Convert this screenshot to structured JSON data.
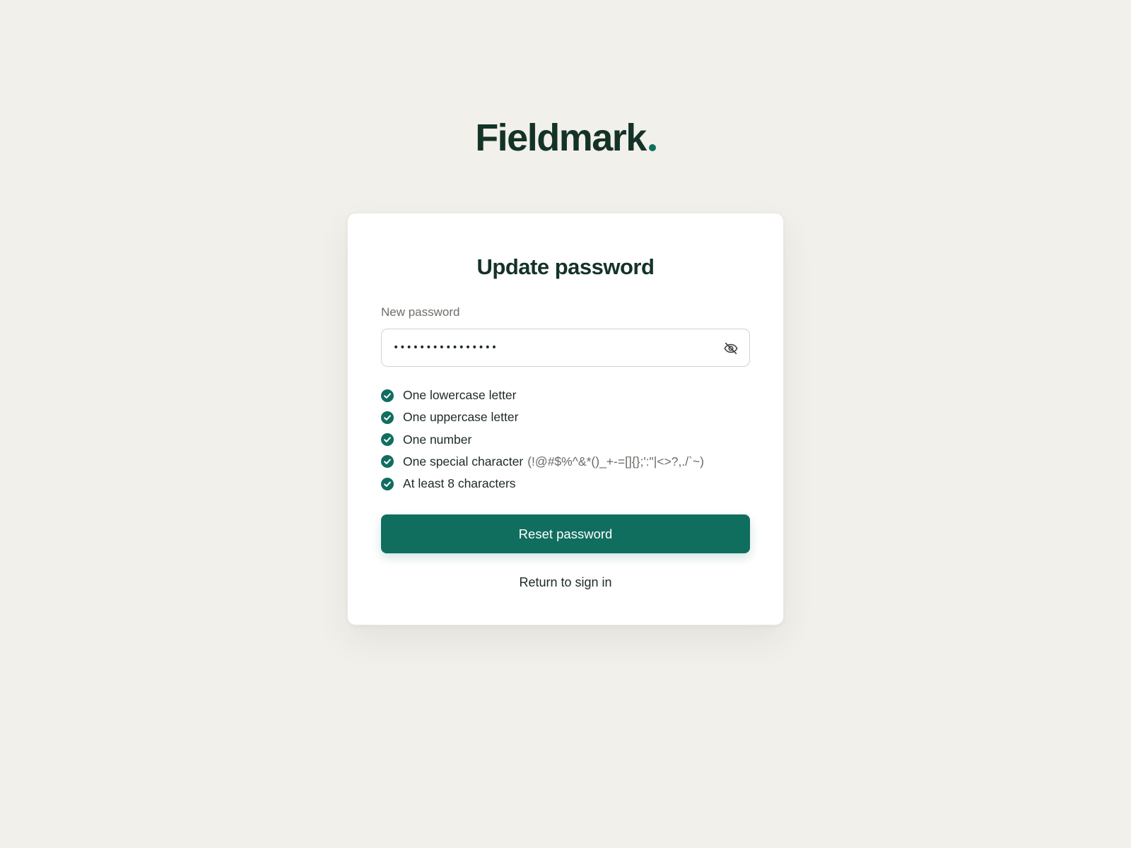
{
  "brand": {
    "name": "Fieldmark",
    "accent_color": "#106e5f",
    "text_color": "#143328"
  },
  "card": {
    "title": "Update password",
    "password_field": {
      "label": "New password",
      "value": "••••••••••••••••",
      "toggle_icon": "eye-off-icon"
    },
    "requirements": [
      {
        "label": "One lowercase letter",
        "hint": "",
        "met": true
      },
      {
        "label": "One uppercase letter",
        "hint": "",
        "met": true
      },
      {
        "label": "One number",
        "hint": "",
        "met": true
      },
      {
        "label": "One special character",
        "hint": "(!@#$%^&*()_+-=[]{};':\"|<>?,./`~)",
        "met": true
      },
      {
        "label": "At least 8 characters",
        "hint": "",
        "met": true
      }
    ],
    "check_icon": "check-circle-icon",
    "submit_label": "Reset password",
    "return_label": "Return to sign in"
  },
  "colors": {
    "background": "#f2f0eb",
    "card_background": "#ffffff",
    "button": "#106e5f",
    "check": "#106e5f"
  }
}
